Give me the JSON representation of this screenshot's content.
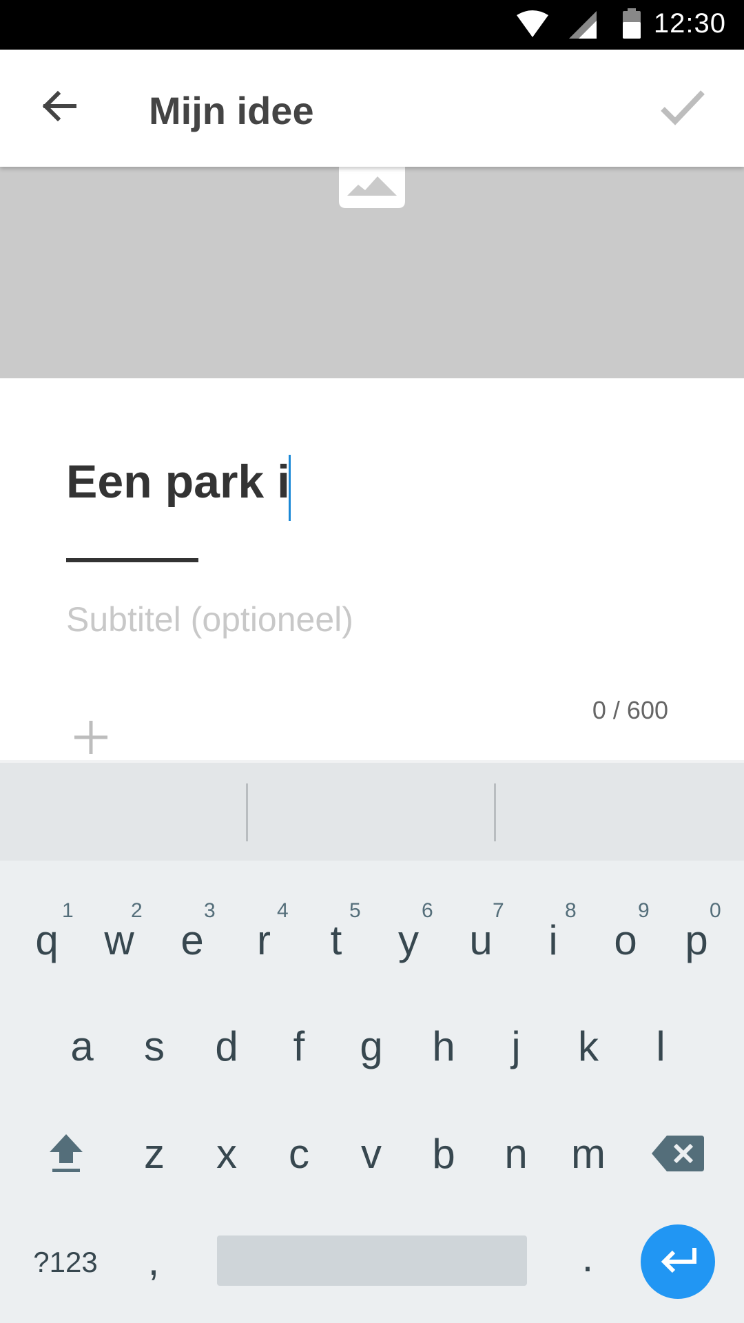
{
  "status_bar": {
    "time": "12:30"
  },
  "app_bar": {
    "title": "Mijn idee"
  },
  "editor": {
    "title_value": "Een park i",
    "subtitle_placeholder": "Subtitel (optioneel)",
    "char_counter": "0 / 600"
  },
  "keyboard": {
    "row1": [
      {
        "key": "q",
        "hint": "1"
      },
      {
        "key": "w",
        "hint": "2"
      },
      {
        "key": "e",
        "hint": "3"
      },
      {
        "key": "r",
        "hint": "4"
      },
      {
        "key": "t",
        "hint": "5"
      },
      {
        "key": "y",
        "hint": "6"
      },
      {
        "key": "u",
        "hint": "7"
      },
      {
        "key": "i",
        "hint": "8"
      },
      {
        "key": "o",
        "hint": "9"
      },
      {
        "key": "p",
        "hint": "0"
      }
    ],
    "row2": [
      "a",
      "s",
      "d",
      "f",
      "g",
      "h",
      "j",
      "k",
      "l"
    ],
    "row3": [
      "z",
      "x",
      "c",
      "v",
      "b",
      "n",
      "m"
    ],
    "symbols_label": "?123",
    "comma": ",",
    "period": "."
  },
  "colors": {
    "accent": "#2196f3",
    "cursor": "#1a88d6",
    "header_placeholder": "#cacaca",
    "keyboard_bg": "#eceff1"
  },
  "icons": [
    "back-arrow-icon",
    "check-icon",
    "image-icon",
    "plus-icon",
    "shift-icon",
    "backspace-icon",
    "enter-icon",
    "wifi-icon",
    "signal-icon",
    "battery-icon"
  ]
}
